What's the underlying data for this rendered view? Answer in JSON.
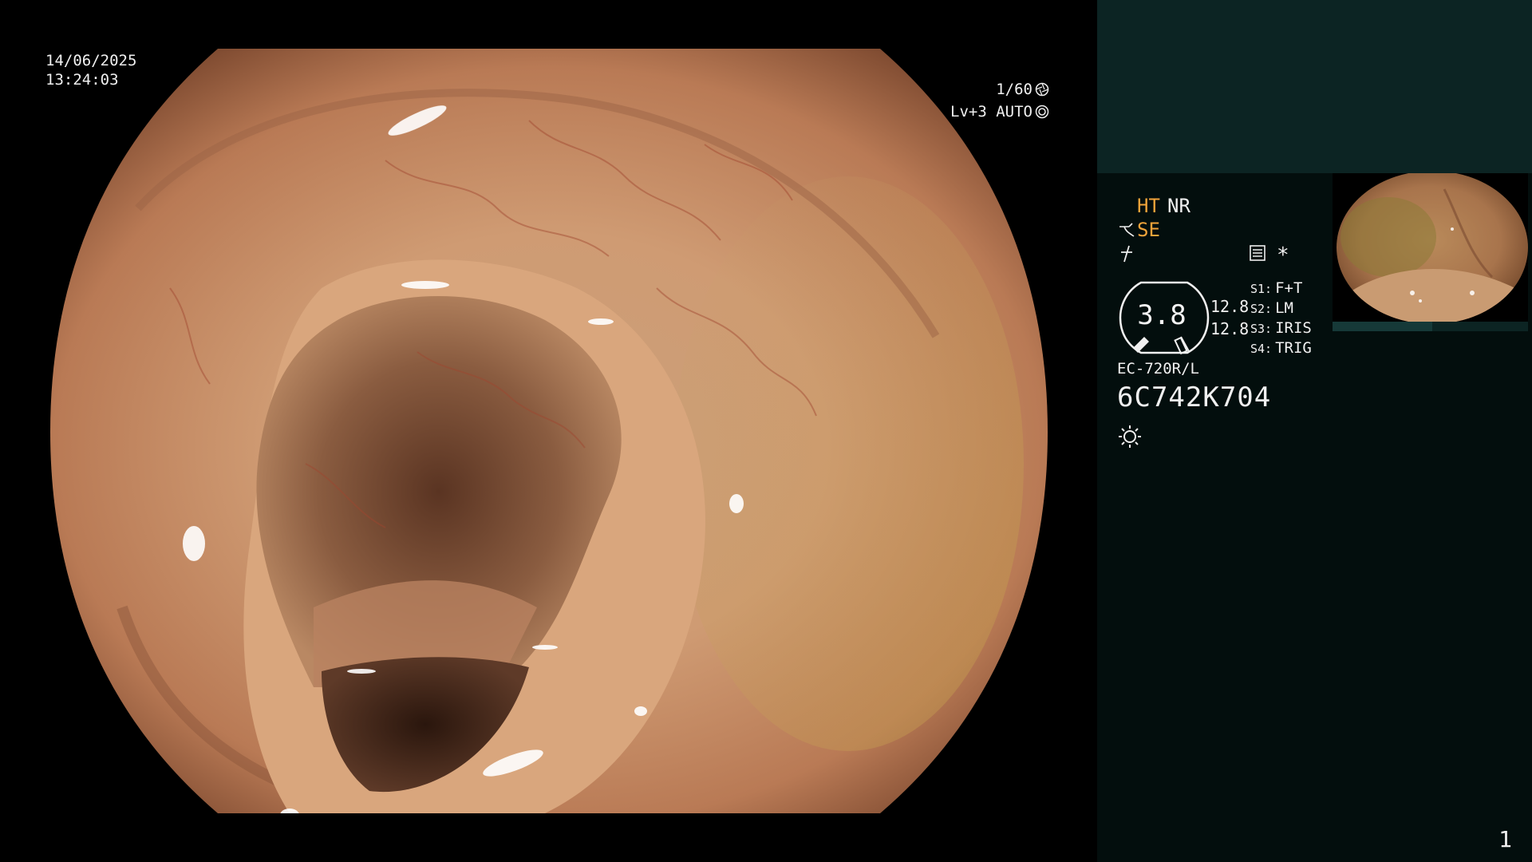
{
  "osd": {
    "date": "14/06/2025",
    "time": "13:24:03",
    "shutter": "1/60",
    "exposure": "Lv+3 AUTO",
    "shutter_icon": "aperture-icon",
    "exposure_icon": "auto-exposure-icon"
  },
  "panel": {
    "mode_ht": "HT",
    "mode_nr": "NR",
    "mode_se": "SE",
    "asterisk": "*",
    "gauge_value": "3.8",
    "level_a": "12.8",
    "level_b": "12.8",
    "switches": [
      {
        "key": "S1:",
        "value": "F+T"
      },
      {
        "key": "S2:",
        "value": "LM"
      },
      {
        "key": "S3:",
        "value": "IRIS"
      },
      {
        "key": "S4:",
        "value": "TRIG"
      }
    ],
    "scope_model": "EC-720R/L",
    "serial": "6C742K704",
    "page_number": "1",
    "colors": {
      "panel_bg": "#030e0d",
      "panel_header": "#0c2423",
      "accent": "#f2a33a"
    }
  }
}
